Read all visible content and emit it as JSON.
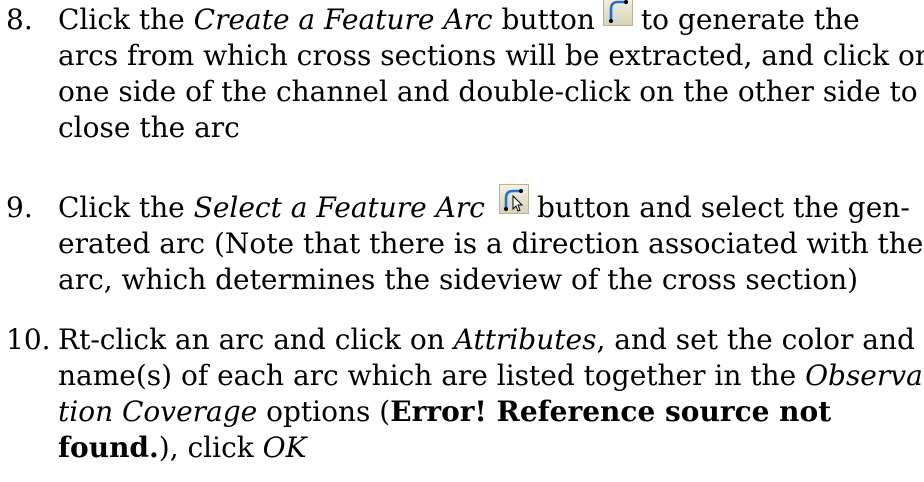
{
  "steps": [
    {
      "number": "8.",
      "line1_pre": "Click the ",
      "line1_italic": "Create a Feature Arc",
      "line1_mid": " button",
      "line1_post": "to generate the",
      "icon": "create-feature-arc-icon",
      "line2": "arcs from which cross sections will be extracted, and click on",
      "line3": "one side of the channel and double-click on the other side to",
      "line4": "close the arc"
    },
    {
      "number": "9.",
      "line1_pre": "Click the ",
      "line1_italic": "Select a Feature Arc",
      "line1_post": "button and select the gen-",
      "icon": "select-feature-arc-icon",
      "line2": "erated arc (Note that there is a direction associated with the",
      "line3": "arc, which determines the sideview of the cross section)"
    },
    {
      "number": "10.",
      "line1_pre": "Rt-click an arc and click on ",
      "line1_italic": "Attributes",
      "line1_post": ", and set the color and",
      "line2_pre": "name(s) of each arc which are listed together in the ",
      "line2_italic": "Observa-",
      "line3_italic": "tion Coverage",
      "line3_mid": " options (",
      "line3_bold": "Error! Reference source not",
      "line4_bold": "found.",
      "line4_mid": "), click ",
      "line4_italic": "OK"
    }
  ],
  "colors": {
    "icon_arc": "#1f6fd0",
    "icon_bg": "#e6e1c8"
  }
}
